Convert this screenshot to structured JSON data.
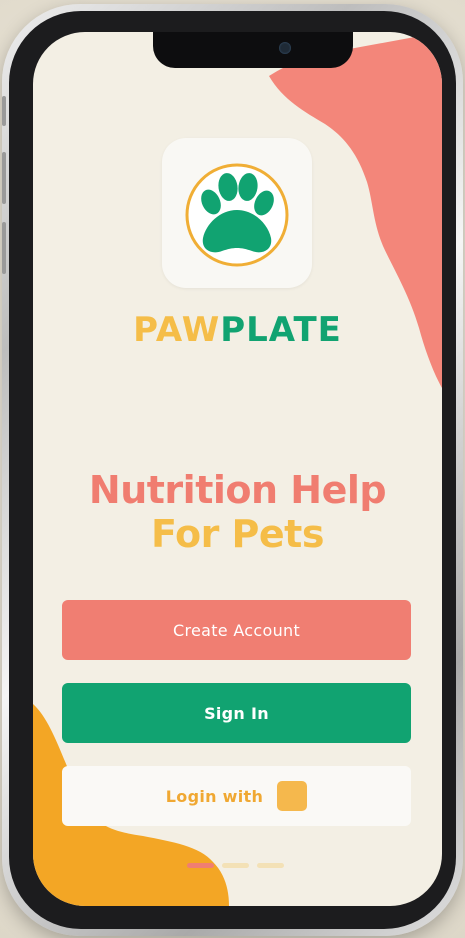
{
  "app": {
    "logo_part1": "PAW",
    "logo_part2": "PLATE",
    "icon": "paw-print-icon"
  },
  "hero": {
    "line1": "Nutrition Help",
    "line2": "For Pets"
  },
  "buttons": {
    "create_account": "Create Account",
    "sign_in": "Sign In",
    "login_with": "Login with",
    "login_provider_icon": "provider-logo-icon"
  },
  "pagination": {
    "total": 3,
    "active_index": 0
  },
  "colors": {
    "coral": "#f07e72",
    "green": "#11a371",
    "yellow": "#f5bd48",
    "orange": "#f3a625",
    "background": "#f3efe4"
  }
}
